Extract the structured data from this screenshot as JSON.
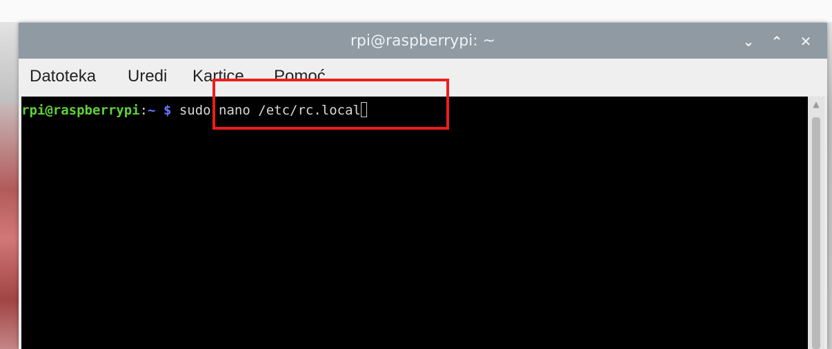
{
  "window": {
    "title": "rpi@raspberrypi: ~",
    "controls": {
      "minimize": "⌄",
      "maximize": "⌃",
      "close": "✕"
    }
  },
  "menu": {
    "items": [
      {
        "label": "Datoteka"
      },
      {
        "label": "Uredi"
      },
      {
        "label": "Kartice"
      },
      {
        "label": "Pomoć"
      }
    ]
  },
  "terminal": {
    "prompt_user": "rpi@raspberrypi",
    "prompt_sep": ":",
    "prompt_path": "~",
    "prompt_symbol": "$",
    "command": "sudo nano /etc/rc.local"
  },
  "colors": {
    "titlebar": "#8f9aa3",
    "terminal_bg": "#000000",
    "prompt_user": "#5fd33a",
    "prompt_path": "#6a78ff",
    "highlight": "#ee1c1c"
  }
}
